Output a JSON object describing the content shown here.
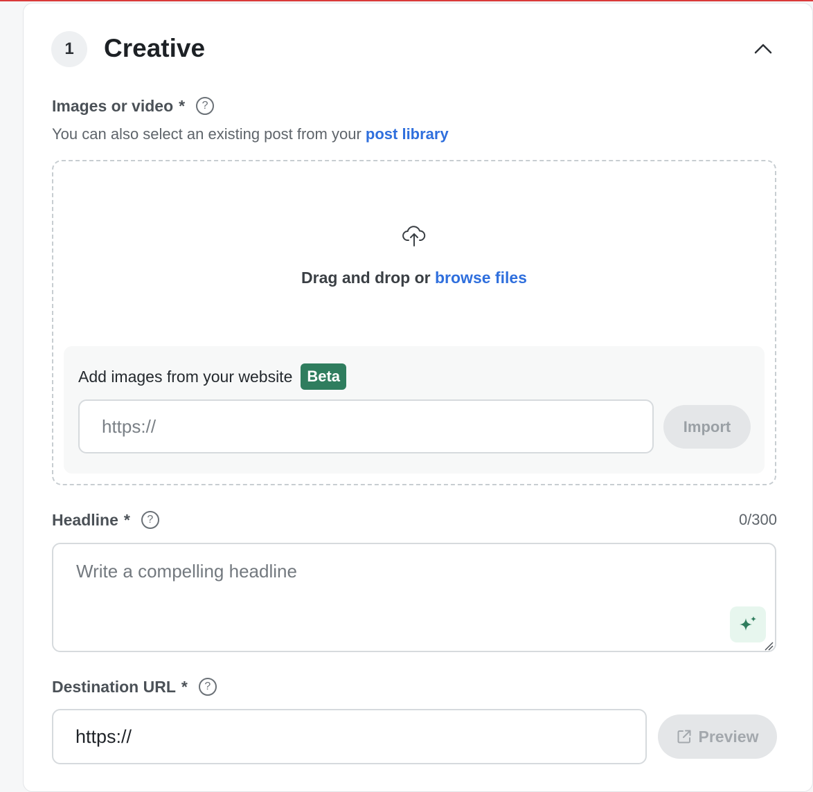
{
  "section": {
    "step_number": "1",
    "title": "Creative"
  },
  "images": {
    "label": "Images or video",
    "required_mark": "*",
    "help": "?",
    "subtext": "You can also select an existing post from your",
    "library_link": "post library",
    "drop_text": "Drag and drop or",
    "browse_link": "browse files"
  },
  "website": {
    "label": "Add images from your website",
    "badge": "Beta",
    "placeholder": "https://",
    "import_label": "Import"
  },
  "headline": {
    "label": "Headline",
    "required_mark": "*",
    "help": "?",
    "counter": "0/300",
    "placeholder": "Write a compelling headline"
  },
  "destination": {
    "label": "Destination URL",
    "required_mark": "*",
    "help": "?",
    "value": "https://",
    "preview_label": "Preview"
  },
  "colors": {
    "link": "#2f6fdd",
    "badge": "#2f7d5e",
    "ai_accent": "#2f7d5e"
  },
  "icons": {
    "collapse": "chevron-up-icon",
    "upload": "cloud-upload-icon",
    "ai": "sparkle-icon",
    "external": "external-link-icon",
    "help": "question-circle-icon"
  }
}
